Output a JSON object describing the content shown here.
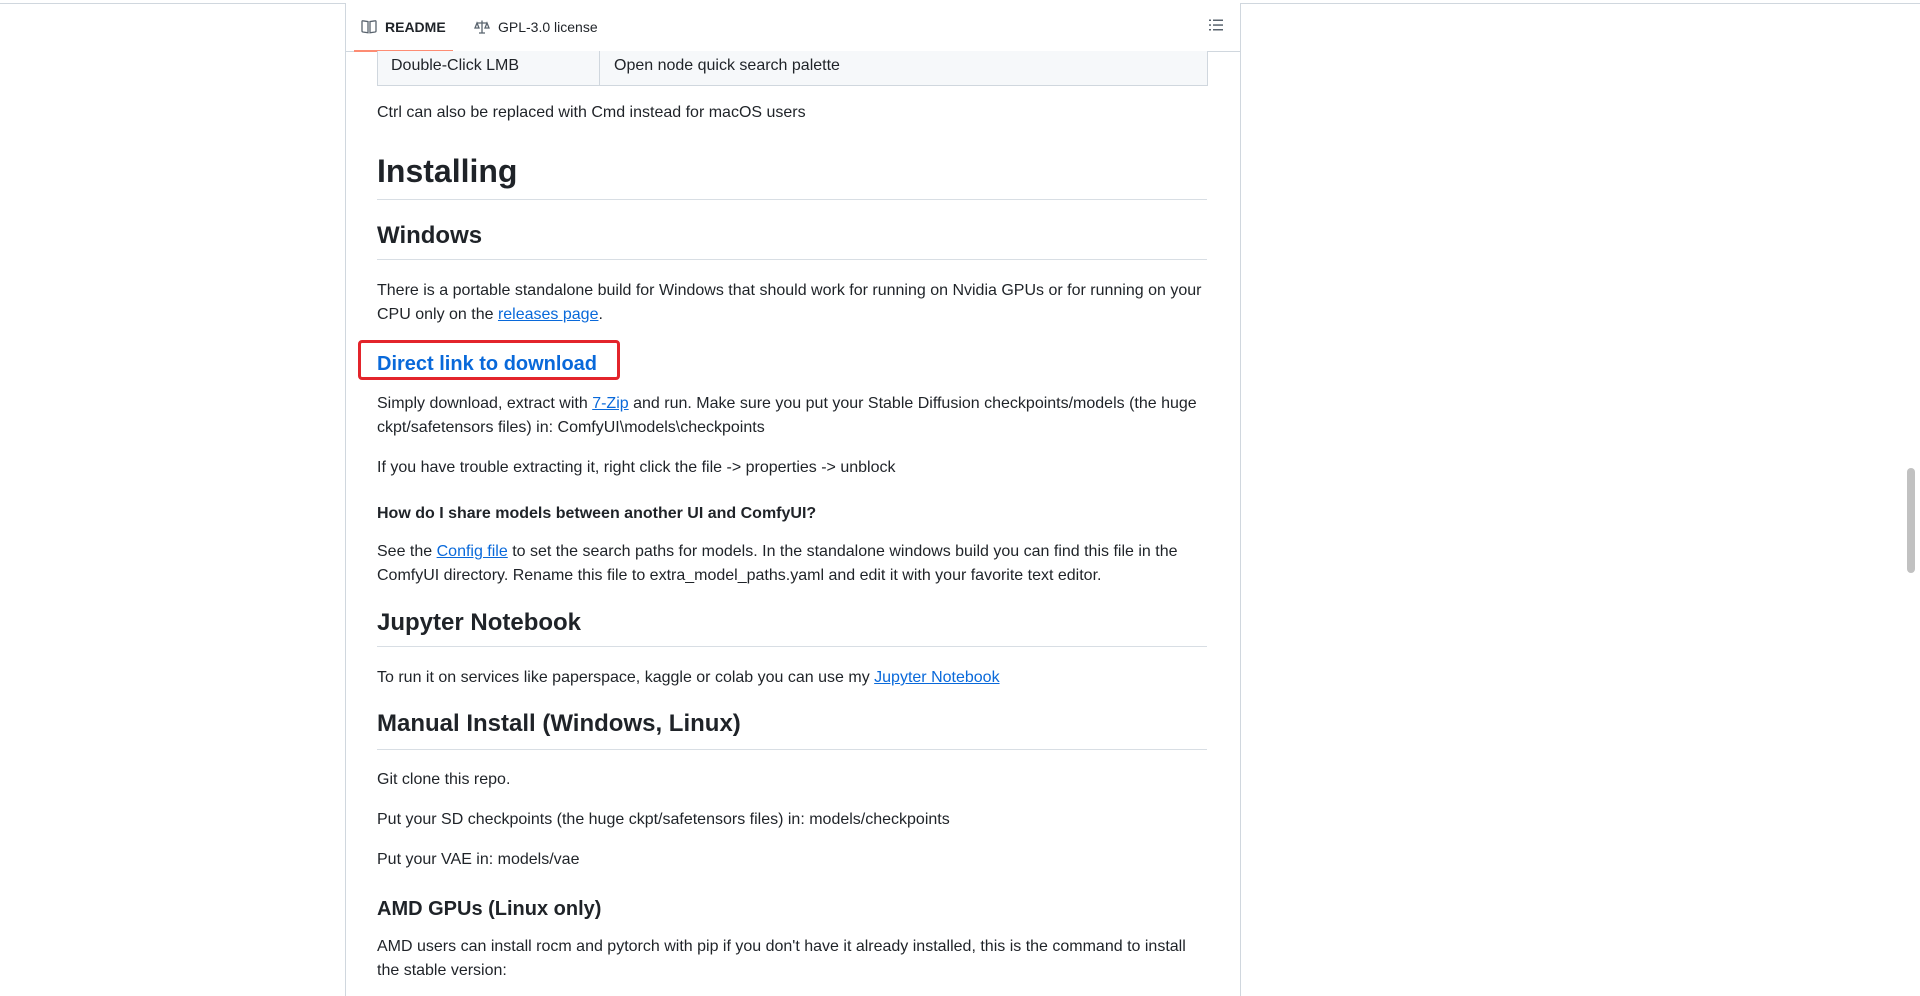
{
  "tabs": {
    "readme": "README",
    "license": "GPL-3.0 license"
  },
  "table": {
    "row": {
      "key": "Double-Click LMB",
      "action": "Open node quick search palette"
    }
  },
  "ctrl_note": "Ctrl can also be replaced with Cmd instead for macOS users",
  "installing": {
    "title": "Installing",
    "windows": {
      "title": "Windows",
      "text_before": "There is a portable standalone build for Windows that should work for running on Nvidia GPUs or for running on your CPU only on the ",
      "releases_link": "releases page",
      "text_after": ".",
      "direct_link": "Direct link to download",
      "extract_before": "Simply download, extract with ",
      "zip_link": "7-Zip",
      "extract_after": " and run. Make sure you put your Stable Diffusion checkpoints/models (the huge ckpt/safetensors files) in: ComfyUI\\models\\checkpoints",
      "trouble": "If you have trouble extracting it, right click the file -> properties -> unblock",
      "share_q": "How do I share models between another UI and ComfyUI?",
      "see_before": "See the ",
      "config_link": "Config file",
      "see_after": " to set the search paths for models. In the standalone windows build you can find this file in the ComfyUI directory. Rename this file to extra_model_paths.yaml and edit it with your favorite text editor."
    },
    "jupyter": {
      "title": "Jupyter Notebook",
      "text_before": "To run it on services like paperspace, kaggle or colab you can use my ",
      "link": "Jupyter Notebook"
    },
    "manual": {
      "title": "Manual Install (Windows, Linux)",
      "clone": "Git clone this repo.",
      "checkpoints": "Put your SD checkpoints (the huge ckpt/safetensors files) in: models/checkpoints",
      "vae": "Put your VAE in: models/vae"
    },
    "amd": {
      "title": "AMD GPUs (Linux only)",
      "text": "AMD users can install rocm and pytorch with pip if you don't have it already installed, this is the command to install the stable version:"
    }
  },
  "colors": {
    "link": "#0969da",
    "highlight": "#e3242b",
    "tab_underline": "#fd8c73"
  },
  "icons": [
    "book-icon",
    "scale-icon",
    "list-icon"
  ]
}
